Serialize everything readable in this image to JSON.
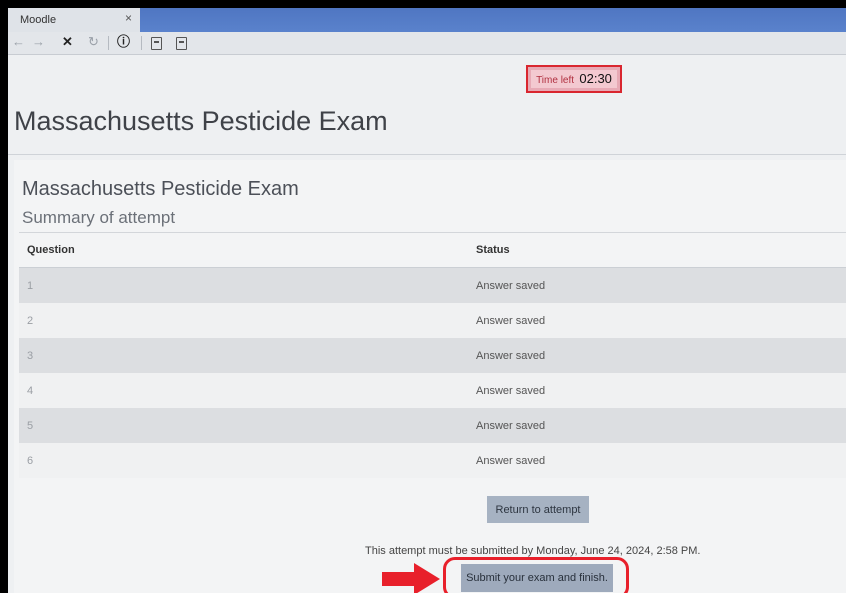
{
  "browser": {
    "tab_title": "Moodle",
    "tab_close": "×",
    "nav": {
      "back": "←",
      "forward": "→",
      "stop": "✕",
      "refresh": "↻",
      "info": "ⓘ"
    }
  },
  "timer": {
    "label": "Time left",
    "value": "02:30"
  },
  "page": {
    "title": "Massachusetts Pesticide Exam"
  },
  "summary": {
    "exam_name": "Massachusetts Pesticide Exam",
    "heading": "Summary of attempt",
    "columns": [
      "Question",
      "Status"
    ],
    "rows": [
      {
        "question": "1",
        "status": "Answer saved"
      },
      {
        "question": "2",
        "status": "Answer saved"
      },
      {
        "question": "3",
        "status": "Answer saved"
      },
      {
        "question": "4",
        "status": "Answer saved"
      },
      {
        "question": "5",
        "status": "Answer saved"
      },
      {
        "question": "6",
        "status": "Answer saved"
      }
    ]
  },
  "actions": {
    "return_label": "Return to attempt",
    "deadline_text": "This attempt must be submitted by Monday, June 24, 2024, 2:58 PM.",
    "submit_label": "Submit your exam and finish."
  },
  "annotation": {
    "color": "#e8202b",
    "arrow_icon": "right-arrow-icon"
  }
}
